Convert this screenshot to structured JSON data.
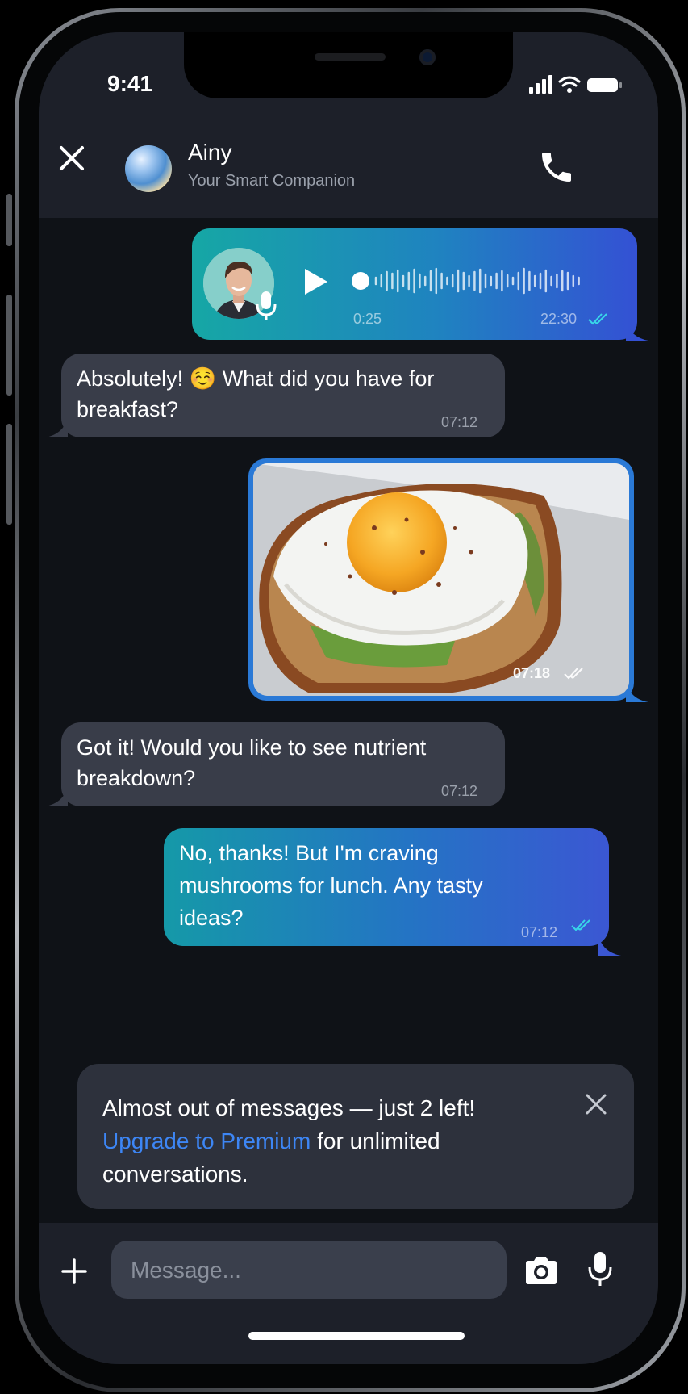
{
  "status_bar": {
    "time": "9:41"
  },
  "header": {
    "contact_name": "Ainy",
    "contact_subtitle": "Your Smart Companion"
  },
  "messages": {
    "voice": {
      "duration": "0:25",
      "time": "22:30"
    },
    "msg1": {
      "line1": "Absolutely! ☺️ What did you have for",
      "line2": "breakfast?",
      "time": "07:12"
    },
    "photo": {
      "time": "07:18"
    },
    "msg2": {
      "line1": "Got it! Would you like to see nutrient",
      "line2": "breakdown?",
      "time": "07:12"
    },
    "msg3": {
      "line1": "No, thanks! But I'm craving",
      "line2": "mushrooms for lunch. Any tasty",
      "line3": "ideas?",
      "time": "07:12"
    }
  },
  "banner": {
    "line1": "Almost out of messages — just 2 left!",
    "link_text": "Upgrade to Premium",
    "line2_rest": " for unlimited",
    "line3": "conversations."
  },
  "composer": {
    "placeholder": "Message..."
  },
  "icons": {
    "close": "close-icon",
    "call": "phone-icon",
    "play": "play-icon",
    "add": "plus-icon",
    "camera": "camera-icon",
    "mic": "mic-icon"
  },
  "colors": {
    "accent_link": "#3d86f5",
    "incoming_bubble": "#393d49",
    "check_read": "#38d6e8"
  }
}
